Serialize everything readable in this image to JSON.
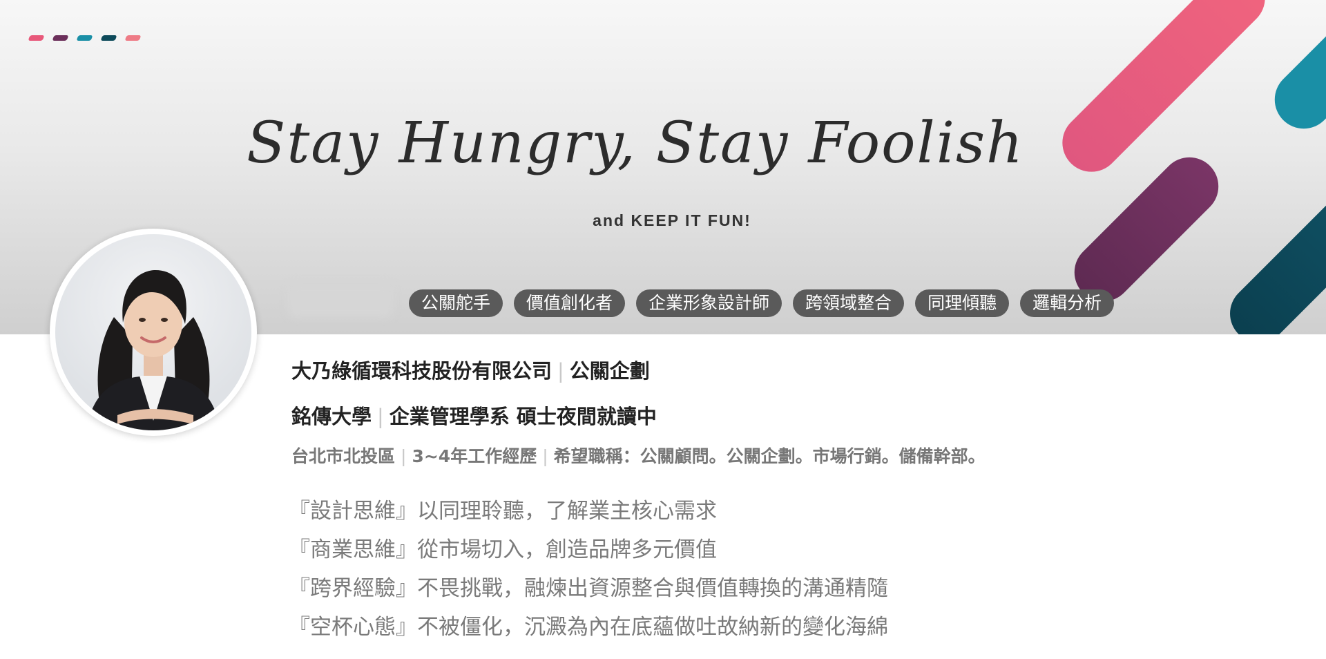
{
  "banner": {
    "tagline": "Stay Hungry, Stay Foolish",
    "subtagline": "and KEEP IT FUN!",
    "dot_colors": [
      "#e8587a",
      "#6b2f5a",
      "#1a8fa6",
      "#0d4a5a",
      "#ee7b86"
    ],
    "accent_colors": {
      "pink": "#e8587a",
      "plum": "#6a2f5a",
      "teal": "#1a8fa6",
      "navy": "#0e4a5c"
    }
  },
  "skills": [
    {
      "label": "公關舵手"
    },
    {
      "label": "價值創化者"
    },
    {
      "label": "企業形象設計師"
    },
    {
      "label": "跨領域整合"
    },
    {
      "label": "同理傾聽"
    },
    {
      "label": "邏輯分析"
    }
  ],
  "profile": {
    "company": "大乃綠循環科技股份有限公司",
    "position": "公關企劃",
    "school": "銘傳大學",
    "department": "企業管理學系 碩士夜間就讀中",
    "location": "台北市北投區",
    "experience": "3~4年工作經歷",
    "desired_titles": "希望職稱：公關顧問。公關企劃。市場行銷。儲備幹部。"
  },
  "mottos": [
    "『設計思維』以同理聆聽，了解業主核心需求",
    "『商業思維』從市場切入，創造品牌多元價值",
    "『跨界經驗』不畏挑戰，融煉出資源整合與價值轉換的溝通精隨",
    "『空杯心態』不被僵化，沉澱為內在底蘊做吐故納新的變化海綿"
  ]
}
